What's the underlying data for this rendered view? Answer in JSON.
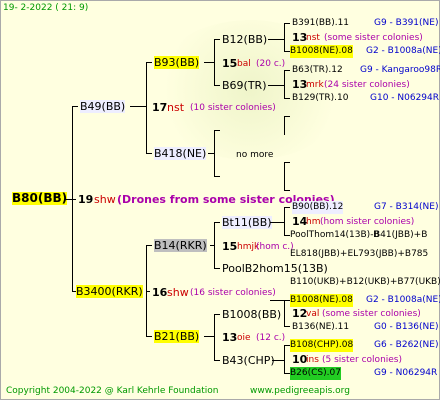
{
  "timestamp": "19-  2-2022 ( 21:  9)",
  "root": {
    "label": "B80(BB)",
    "gen": "19",
    "mark": "shw",
    "note": "(Drones from some sister colonies)"
  },
  "gen18": [
    {
      "label": "B49(BB)",
      "gen": "17",
      "mark": "nst",
      "note": "(10 sister colonies)"
    },
    {
      "label": "B3400(RKR)",
      "gen": "16",
      "mark": "shw",
      "note": "(16 sister colonies)"
    }
  ],
  "gen17": [
    {
      "label": "B93(BB)",
      "gen": "15",
      "mark": "bal",
      "note": "(20 c.)"
    },
    {
      "label": "B418(NE)",
      "no_more": "no more"
    },
    {
      "label": "B14(RKR)",
      "gen": "15",
      "mark": "hmjk",
      "note": "(hom c.)"
    },
    {
      "label": "B21(BB)",
      "gen": "13",
      "mark": "oie",
      "note": "(12 c.)"
    }
  ],
  "gen16": [
    {
      "label": "B12(BB)"
    },
    {
      "label": "B69(TR)"
    },
    {
      "label": "Bt11(BB)",
      "gen": "14",
      "mark": "hm",
      "note": "(hom sister colonies)"
    },
    {
      "label": "PoolB2hom15(13B)"
    },
    {
      "label": "B1008(BB)",
      "gen": "12",
      "mark": "val",
      "note": "(some sister colonies)"
    },
    {
      "label": "B43(CHP)",
      "gen": "10",
      "mark": "ins",
      "note": "(5 sister colonies)"
    }
  ],
  "gen15": [
    {
      "label": "B391(BB).11",
      "id": "G9 - B391(NE)"
    },
    {
      "label": "13",
      "mark": "nst",
      "note": "(some sister colonies)"
    },
    {
      "label": "B1008(NE).08",
      "id": "G2 - B1008a(NE)"
    },
    {
      "label": "B63(TR).12",
      "id": "G9 - Kangaroo98R"
    },
    {
      "label": "13",
      "mark": "mrk",
      "note": "(24 sister colonies)"
    },
    {
      "label": "B129(TR).10",
      "id": "G10 - N06294R"
    },
    {
      "label": "B90(BB).12",
      "id": "G7 - B314(NE)"
    },
    {
      "label": "PoolThom14(13B)-B",
      "id": "B41(JBB)+B"
    },
    {
      "label": "EL818(JBB)+EL793(JBB)+B785"
    },
    {
      "label": "B110(UKB)+B12(UKB)+B77(UKB)"
    },
    {
      "label": "B1008(NE).08",
      "id": "G2 - B1008a(NE)"
    },
    {
      "label": "B136(NE).11",
      "id": "G0 - B136(NE)"
    },
    {
      "label": "B108(CHP).08",
      "id": "G6 - B262(NE)"
    },
    {
      "label": "B26(CS).07",
      "id": "G9 - N06294R"
    }
  ],
  "footer": {
    "copyright": "Copyright 2004-2022 @ Karl Kehrle Foundation",
    "site": "www.pedigreeapis.org"
  }
}
